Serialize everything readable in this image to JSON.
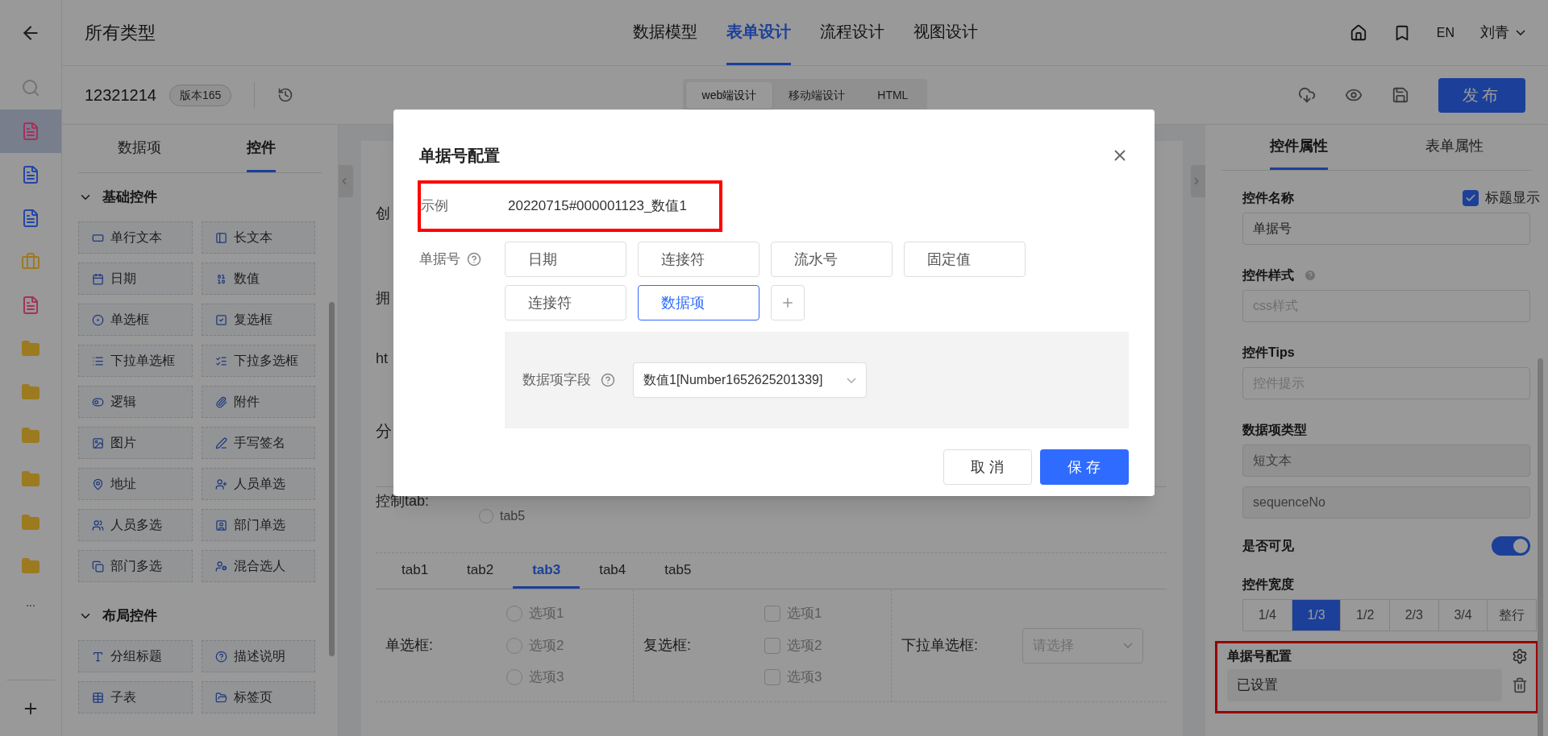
{
  "rail": {
    "items": [
      {
        "kind": "search",
        "color": "#737373",
        "selected": false
      },
      {
        "kind": "doc",
        "color": "#a3335c",
        "selected": true
      },
      {
        "kind": "doc",
        "color": "#2346a6",
        "selected": false
      },
      {
        "kind": "doc",
        "color": "#2346a6",
        "selected": false
      },
      {
        "kind": "case",
        "color": "#9c7a20",
        "selected": false
      },
      {
        "kind": "doc",
        "color": "#a3335c",
        "selected": false
      },
      {
        "kind": "folder",
        "color": "#9c7a20",
        "selected": false
      },
      {
        "kind": "folder",
        "color": "#9c7a20",
        "selected": false
      },
      {
        "kind": "folder",
        "color": "#9c7a20",
        "selected": false
      },
      {
        "kind": "folder",
        "color": "#9c7a20",
        "selected": false
      },
      {
        "kind": "folder",
        "color": "#9c7a20",
        "selected": false
      },
      {
        "kind": "folder",
        "color": "#9c7a20",
        "selected": false
      }
    ],
    "more": "..."
  },
  "header": {
    "title": "所有类型",
    "nav": [
      {
        "label": "数据模型",
        "selected": false
      },
      {
        "label": "表单设计",
        "selected": true
      },
      {
        "label": "流程设计",
        "selected": false
      },
      {
        "label": "视图设计",
        "selected": false
      }
    ],
    "lang": "EN",
    "user": "刘青"
  },
  "toolbar": {
    "form_id": "12321214",
    "version": "版本165",
    "modes": [
      {
        "label": "web端设计",
        "selected": true
      },
      {
        "label": "移动端设计",
        "selected": false
      },
      {
        "label": "HTML",
        "selected": false
      }
    ],
    "publish": "发布"
  },
  "left_panel": {
    "tabs": [
      {
        "label": "数据项",
        "selected": false
      },
      {
        "label": "控件",
        "selected": true
      }
    ],
    "groups": [
      {
        "title": "基础控件",
        "expanded": true,
        "items": [
          {
            "label": "单行文本",
            "kind": "textline"
          },
          {
            "label": "长文本",
            "kind": "textarea"
          },
          {
            "label": "日期",
            "kind": "date"
          },
          {
            "label": "数值",
            "kind": "number"
          },
          {
            "label": "单选框",
            "kind": "radio"
          },
          {
            "label": "复选框",
            "kind": "checkbox"
          },
          {
            "label": "下拉单选框",
            "kind": "list"
          },
          {
            "label": "下拉多选框",
            "kind": "checklist"
          },
          {
            "label": "逻辑",
            "kind": "toggle"
          },
          {
            "label": "附件",
            "kind": "clip"
          },
          {
            "label": "图片",
            "kind": "image"
          },
          {
            "label": "手写签名",
            "kind": "pen"
          },
          {
            "label": "地址",
            "kind": "pin"
          },
          {
            "label": "人员单选",
            "kind": "user"
          },
          {
            "label": "人员多选",
            "kind": "users"
          },
          {
            "label": "部门单选",
            "kind": "dept"
          },
          {
            "label": "部门多选",
            "kind": "depts"
          },
          {
            "label": "混合选人",
            "kind": "mixed"
          }
        ]
      },
      {
        "title": "布局控件",
        "expanded": true,
        "items": [
          {
            "label": "分组标题",
            "kind": "title"
          },
          {
            "label": "描述说明",
            "kind": "help"
          },
          {
            "label": "子表",
            "kind": "table"
          },
          {
            "label": "标签页",
            "kind": "tabs"
          }
        ]
      }
    ]
  },
  "canvas": {
    "rows": [
      {
        "label": "创"
      },
      {
        "label": "拥"
      },
      {
        "label": "ht"
      }
    ],
    "section": "分",
    "control_tab": {
      "label": "控制tab:",
      "option": "tab5",
      "checked": false
    },
    "tabs": [
      {
        "label": "tab1",
        "selected": false
      },
      {
        "label": "tab2",
        "selected": false
      },
      {
        "label": "tab3",
        "selected": true
      },
      {
        "label": "tab4",
        "selected": false
      },
      {
        "label": "tab5",
        "selected": false
      }
    ],
    "fields": [
      {
        "kind": "radio",
        "label": "单选框:",
        "options": [
          {
            "label": "选项1",
            "checked": false
          },
          {
            "label": "选项2",
            "checked": false
          },
          {
            "label": "选项3",
            "checked": false
          }
        ]
      },
      {
        "kind": "checkbox",
        "label": "复选框:",
        "options": [
          {
            "label": "选项1",
            "checked": false
          },
          {
            "label": "选项2",
            "checked": false
          },
          {
            "label": "选项3",
            "checked": false
          }
        ]
      },
      {
        "kind": "select",
        "label": "下拉单选框:",
        "placeholder": "请选择"
      }
    ]
  },
  "right_panel": {
    "tabs": [
      {
        "label": "控件属性",
        "selected": true
      },
      {
        "label": "表单属性",
        "selected": false
      }
    ],
    "name": {
      "label": "控件名称",
      "show_title": {
        "label": "标题显示",
        "checked": true
      },
      "value": "单据号"
    },
    "style": {
      "label": "控件样式",
      "placeholder": "css样式"
    },
    "tips": {
      "label": "控件Tips",
      "placeholder": "控件提示"
    },
    "data_type": {
      "label": "数据项类型",
      "values": [
        "短文本",
        "sequenceNo"
      ]
    },
    "visible": {
      "label": "是否可见",
      "on": true
    },
    "width": {
      "label": "控件宽度",
      "options": [
        {
          "label": "1/4",
          "selected": false
        },
        {
          "label": "1/3",
          "selected": true
        },
        {
          "label": "1/2",
          "selected": false
        },
        {
          "label": "2/3",
          "selected": false
        },
        {
          "label": "3/4",
          "selected": false
        },
        {
          "label": "整行",
          "selected": false
        }
      ]
    },
    "number_config": {
      "label": "单据号配置",
      "value": "已设置",
      "highlighted": true
    }
  },
  "modal": {
    "title": "单据号配置",
    "example": {
      "label": "示例",
      "value": "20220715#000001123_数值1",
      "highlighted": true
    },
    "number": {
      "label": "单据号",
      "parts": [
        {
          "label": "日期",
          "selected": false
        },
        {
          "label": "连接符",
          "selected": false
        },
        {
          "label": "流水号",
          "selected": false
        },
        {
          "label": "固定值",
          "selected": false
        },
        {
          "label": "连接符",
          "selected": false
        },
        {
          "label": "数据项",
          "selected": true
        }
      ]
    },
    "field": {
      "label": "数据项字段",
      "value": "数值1[Number1652625201339]"
    },
    "cancel": "取 消",
    "save": "保 存"
  }
}
